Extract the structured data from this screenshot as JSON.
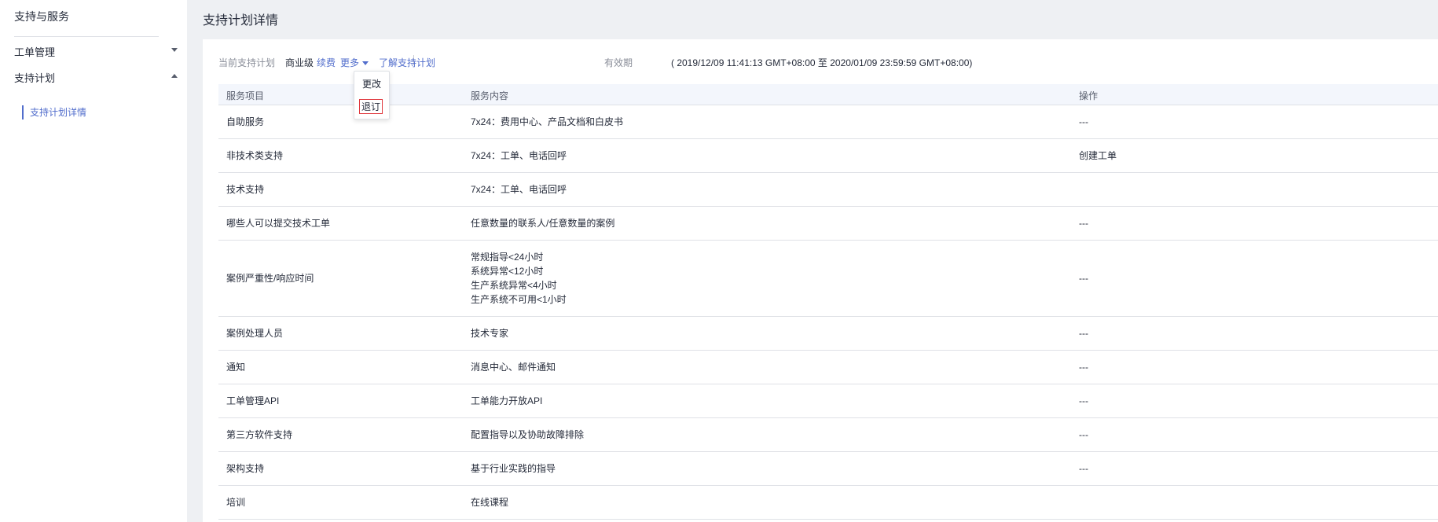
{
  "sidebar": {
    "title": "支持与服务",
    "items": [
      {
        "label": "工单管理",
        "expanded": false
      },
      {
        "label": "支持计划",
        "expanded": true
      }
    ],
    "sub_item": "支持计划详情"
  },
  "page": {
    "title": "支持计划详情"
  },
  "info": {
    "current_plan_label": "当前支持计划",
    "plan_level": "商业级",
    "renew": "续费",
    "more": "更多",
    "learn_more": "了解支持计划",
    "validity_label": "有效期",
    "validity_value": "( 2019/12/09 11:41:13 GMT+08:00 至 2020/01/09 23:59:59 GMT+08:00)"
  },
  "dropdown": {
    "items": [
      "更改",
      "退订"
    ]
  },
  "table": {
    "headers": [
      "服务项目",
      "服务内容",
      "操作"
    ],
    "rows": [
      {
        "item": "自助服务",
        "content": "7x24：费用中心、产品文档和白皮书",
        "action": "---"
      },
      {
        "item": "非技术类支持",
        "content": "7x24：工单、电话回呼",
        "action": "创建工单"
      },
      {
        "item": "技术支持",
        "content": "7x24：工单、电话回呼",
        "action": ""
      },
      {
        "item": "哪些人可以提交技术工单",
        "content": "任意数量的联系人/任意数量的案例",
        "action": "---"
      },
      {
        "item": "案例严重性/响应时间",
        "content": "常规指导<24小时\n系统异常<12小时\n生产系统异常<4小时\n生产系统不可用<1小时",
        "action": "---"
      },
      {
        "item": "案例处理人员",
        "content": "技术专家",
        "action": "---"
      },
      {
        "item": "通知",
        "content": "消息中心、邮件通知",
        "action": "---"
      },
      {
        "item": "工单管理API",
        "content": "工单能力开放API",
        "action": "---"
      },
      {
        "item": "第三方软件支持",
        "content": "配置指导以及协助故障排除",
        "action": "---"
      },
      {
        "item": "架构支持",
        "content": "基于行业实践的指导",
        "action": "---"
      },
      {
        "item": "培训",
        "content": "在线课程",
        "action": ""
      }
    ]
  },
  "colors": {
    "accent": "#526ecc",
    "highlight_border": "#e0383e"
  }
}
